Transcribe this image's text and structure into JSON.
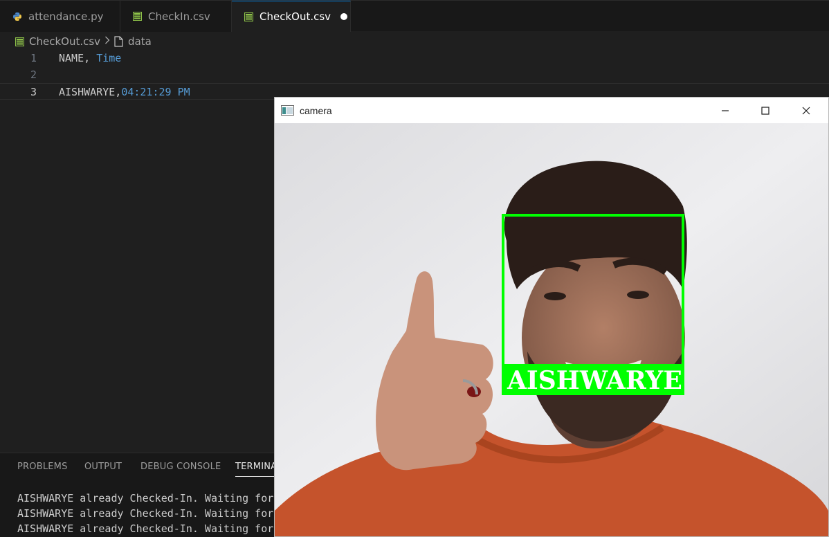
{
  "tabs": [
    {
      "label": "attendance.py",
      "icon": "python-icon",
      "active": false
    },
    {
      "label": "CheckIn.csv",
      "icon": "table-icon",
      "active": false
    },
    {
      "label": "CheckOut.csv",
      "icon": "table-icon",
      "active": true,
      "dirty": true
    }
  ],
  "breadcrumb": {
    "file": "CheckOut.csv",
    "symbol": "data"
  },
  "editor": {
    "lines": [
      {
        "number": "1",
        "name": "NAME, ",
        "value": "Time"
      },
      {
        "number": "2",
        "name": "",
        "value": ""
      },
      {
        "number": "3",
        "name": "AISHWARYE,",
        "value": "04:21:29 PM"
      }
    ]
  },
  "panel": {
    "tabs": [
      "PROBLEMS",
      "OUTPUT",
      "DEBUG CONSOLE",
      "TERMINA"
    ],
    "terminal_lines": [
      "AISHWARYE already Checked-In. Waiting for",
      "AISHWARYE already Checked-In. Waiting for",
      "AISHWARYE already Checked-In. Waiting for"
    ]
  },
  "camera_window": {
    "title": "camera",
    "face_label": "AISHWARYE",
    "box_color": "#00ff00"
  },
  "colors": {
    "accent": "#0078d4",
    "editor_bg": "#1f1f1f",
    "keyword_blue": "#569cd6"
  }
}
